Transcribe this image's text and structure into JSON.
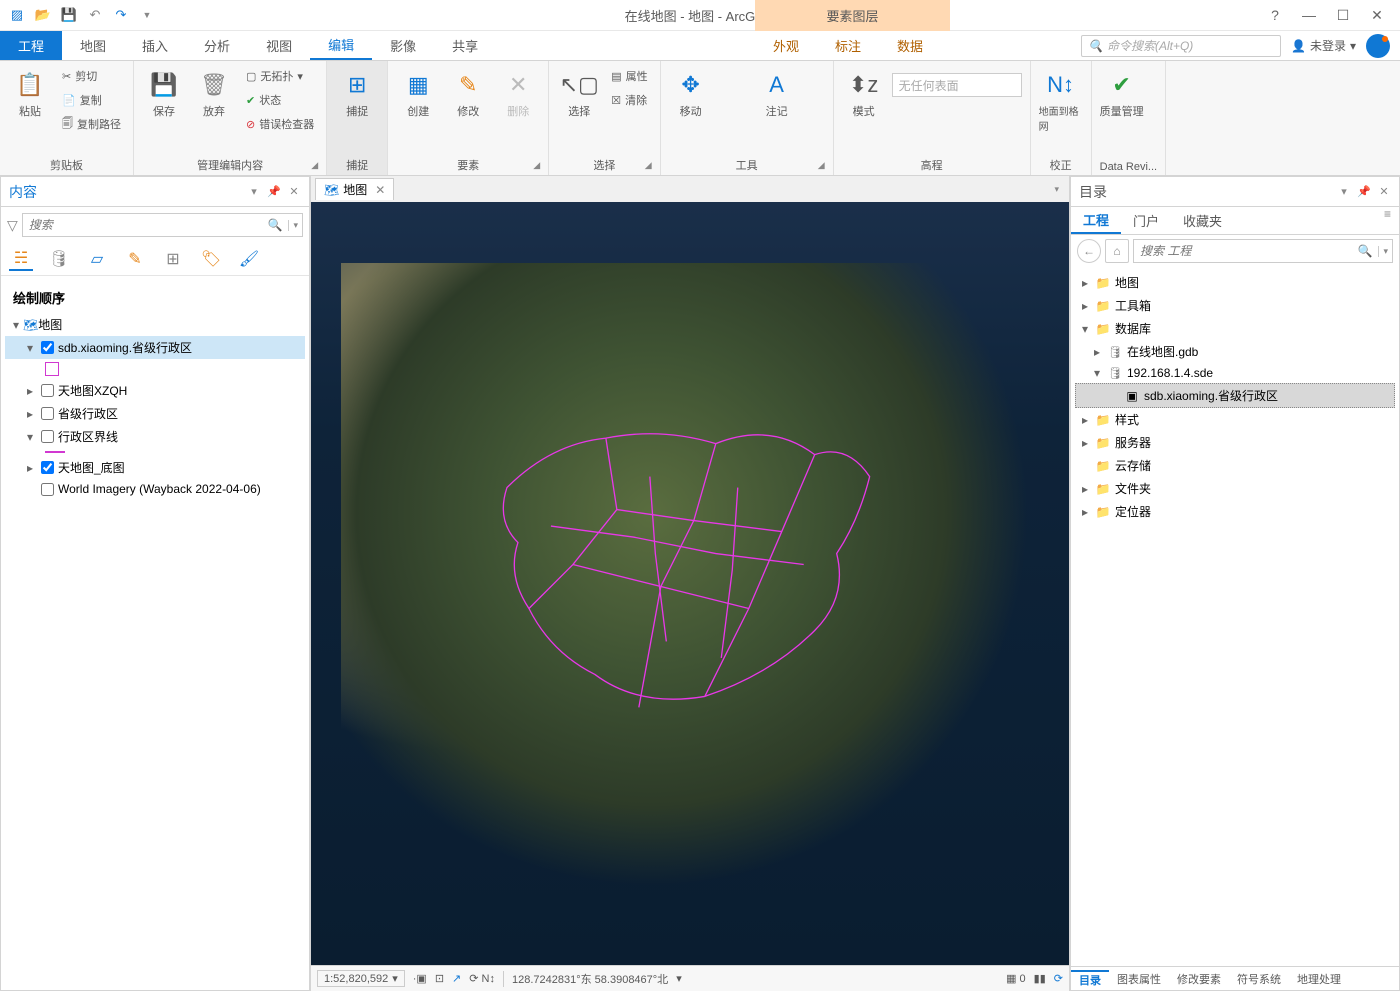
{
  "title": "在线地图 - 地图 - ArcGIS Pro",
  "context_tab": "要素图层",
  "win": {
    "help": "?",
    "min": "—",
    "max": "☐",
    "close": "✕"
  },
  "menu": [
    "工程",
    "地图",
    "插入",
    "分析",
    "视图",
    "编辑",
    "影像",
    "共享"
  ],
  "context_menu": [
    "外观",
    "标注",
    "数据"
  ],
  "cmd_search_placeholder": "命令搜索(Alt+Q)",
  "login": "未登录",
  "ribbon": {
    "paste": "粘贴",
    "cut": "剪切",
    "copy": "复制",
    "copypath": "复制路径",
    "g1": "剪贴板",
    "save": "保存",
    "discard": "放弃",
    "notopo": "无拓扑",
    "status": "状态",
    "errcheck": "错误检查器",
    "g2": "管理编辑内容",
    "snap": "捕捉",
    "g3": "捕捉",
    "create": "创建",
    "modify": "修改",
    "delete": "删除",
    "g4": "要素",
    "select": "选择",
    "attrs": "属性",
    "clearsel": "清除",
    "g5": "选择",
    "move": "移动",
    "annotate": "注记",
    "g6": "工具",
    "mode": "模式",
    "nosurface": "无任何表面",
    "g7": "高程",
    "ground2grid": "地面到格网",
    "g8": "校正",
    "quality": "质量管理",
    "g9": "Data Revi..."
  },
  "contents": {
    "title": "内容",
    "search_placeholder": "搜索",
    "draw_order": "绘制顺序",
    "map": "地图",
    "layers": {
      "l1": "sdb.xiaoming.省级行政区",
      "l2": "天地图XZQH",
      "l3": "省级行政区",
      "l4": "行政区界线",
      "l5": "天地图_底图",
      "l6": "World Imagery (Wayback 2022-04-06)"
    }
  },
  "map": {
    "tab": "地图",
    "scale": "1:52,820,592",
    "coords": "128.7242831°东 58.3908467°北",
    "sel_count": "0"
  },
  "catalog": {
    "title": "目录",
    "tabs": [
      "工程",
      "门户",
      "收藏夹"
    ],
    "search_placeholder": "搜索 工程",
    "items": {
      "maps": "地图",
      "toolbox": "工具箱",
      "database": "数据库",
      "gdb": "在线地图.gdb",
      "sde": "192.168.1.4.sde",
      "fc": "sdb.xiaoming.省级行政区",
      "style": "样式",
      "server": "服务器",
      "cloud": "云存储",
      "folder": "文件夹",
      "locator": "定位器"
    },
    "bottom": [
      "目录",
      "图表属性",
      "修改要素",
      "符号系统",
      "地理处理"
    ]
  }
}
